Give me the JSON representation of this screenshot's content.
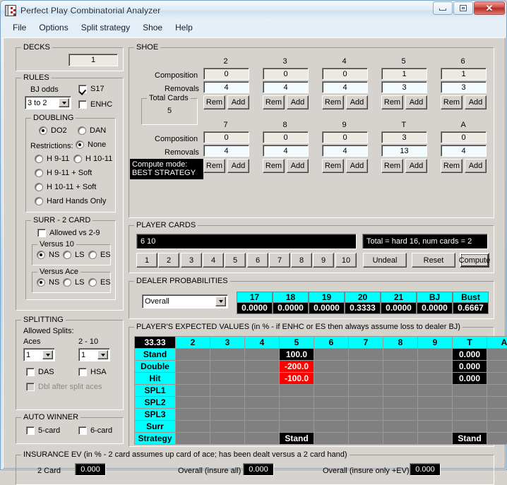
{
  "window": {
    "title": "Perfect Play Combinatorial Analyzer",
    "icon": "playing-card-icon",
    "controls": {
      "minimize": "minimize",
      "maximize": "maximize",
      "close": "close"
    }
  },
  "menubar": [
    "File",
    "Options",
    "Split strategy",
    "Shoe",
    "Help"
  ],
  "decks": {
    "title": "DECKS",
    "value": "1"
  },
  "rules": {
    "title": "RULES",
    "bj_odds_label": "BJ odds",
    "bj_odds_value": "3 to 2",
    "s17": {
      "label": "S17",
      "checked": true
    },
    "enhc": {
      "label": "ENHC",
      "checked": false
    },
    "doubling": {
      "title": "DOUBLING",
      "do2": {
        "label": "DO2",
        "selected": true
      },
      "dan": {
        "label": "DAN",
        "selected": false
      },
      "restrictions_label": "Restrictions:",
      "options": [
        {
          "label": "None",
          "selected": true
        },
        {
          "label": "H 9-11",
          "selected": false
        },
        {
          "label": "H 10-11",
          "selected": false
        },
        {
          "label": "H 9-11 + Soft",
          "selected": false
        },
        {
          "label": "H 10-11 + Soft",
          "selected": false
        },
        {
          "label": "Hard Hands Only",
          "selected": false
        }
      ]
    },
    "surrender": {
      "title": "SURR - 2 CARD",
      "allowed_vs_29": {
        "label": "Allowed vs 2-9",
        "checked": false
      },
      "versus_10": {
        "title": "Versus 10",
        "options": [
          "NS",
          "LS",
          "ES"
        ],
        "selected": "NS"
      },
      "versus_ace": {
        "title": "Versus Ace",
        "options": [
          "NS",
          "LS",
          "ES"
        ],
        "selected": "NS"
      }
    }
  },
  "splitting": {
    "title": "SPLITTING",
    "allowed_splits_label": "Allowed Splits:",
    "aces_label": "Aces",
    "aces_value": "1",
    "two_ten_label": "2 - 10",
    "two_ten_value": "1",
    "das": {
      "label": "DAS",
      "checked": false
    },
    "hsa": {
      "label": "HSA",
      "checked": false
    },
    "dbl_after_split_aces": {
      "label": "Dbl after split aces",
      "checked": false,
      "disabled": true
    }
  },
  "auto_winner": {
    "title": "AUTO WINNER",
    "five_card": {
      "label": "5-card",
      "checked": false
    },
    "six_card": {
      "label": "6-card",
      "checked": false
    }
  },
  "shoe": {
    "title": "SHOE",
    "composition_label": "Composition",
    "removals_label": "Removals",
    "rem_button": "Rem",
    "add_button": "Add",
    "total_cards": {
      "title": "Total Cards",
      "value": "5"
    },
    "compute_mode": {
      "label": "Compute mode:",
      "value": "BEST STRATEGY"
    },
    "row1": [
      {
        "rank": "2",
        "composition": "0",
        "removals": "4"
      },
      {
        "rank": "3",
        "composition": "0",
        "removals": "4"
      },
      {
        "rank": "4",
        "composition": "0",
        "removals": "4"
      },
      {
        "rank": "5",
        "composition": "1",
        "removals": "3"
      },
      {
        "rank": "6",
        "composition": "1",
        "removals": "3"
      }
    ],
    "row2": [
      {
        "rank": "7",
        "composition": "0",
        "removals": "4"
      },
      {
        "rank": "8",
        "composition": "0",
        "removals": "4"
      },
      {
        "rank": "9",
        "composition": "0",
        "removals": "4"
      },
      {
        "rank": "T",
        "composition": "3",
        "removals": "13"
      },
      {
        "rank": "A",
        "composition": "0",
        "removals": "4"
      }
    ]
  },
  "player_cards": {
    "title": "PLAYER CARDS",
    "hand": "6 10",
    "summary": "Total = hard 16, num cards = 2",
    "card_buttons": [
      "1",
      "2",
      "3",
      "4",
      "5",
      "6",
      "7",
      "8",
      "9",
      "10"
    ],
    "undeal": "Undeal",
    "reset": "Reset",
    "compute": "Compute"
  },
  "dealer_probabilities": {
    "title": "DEALER PROBABILITIES",
    "selector_value": "Overall",
    "columns": [
      "17",
      "18",
      "19",
      "20",
      "21",
      "BJ",
      "Bust"
    ],
    "values": [
      "0.0000",
      "0.0000",
      "0.0000",
      "0.3333",
      "0.0000",
      "0.0000",
      "0.6667"
    ]
  },
  "expected_values": {
    "title": "PLAYER'S EXPECTED VALUES (in % - if ENHC or ES then always assume loss to dealer BJ)",
    "corner": "33.33",
    "columns": [
      "2",
      "3",
      "4",
      "5",
      "6",
      "7",
      "8",
      "9",
      "T",
      "A"
    ],
    "rows": [
      {
        "label": "Stand",
        "cells": [
          "",
          "",
          "",
          "100.0",
          "",
          "",
          "",
          "",
          "0.000",
          ""
        ]
      },
      {
        "label": "Double",
        "cells": [
          "",
          "",
          "",
          "-200.0",
          "",
          "",
          "",
          "",
          "0.000",
          ""
        ]
      },
      {
        "label": "Hit",
        "cells": [
          "",
          "",
          "",
          "-100.0",
          "",
          "",
          "",
          "",
          "0.000",
          ""
        ]
      },
      {
        "label": "SPL1",
        "cells": [
          "",
          "",
          "",
          "",
          "",
          "",
          "",
          "",
          "",
          ""
        ]
      },
      {
        "label": "SPL2",
        "cells": [
          "",
          "",
          "",
          "",
          "",
          "",
          "",
          "",
          "",
          ""
        ]
      },
      {
        "label": "SPL3",
        "cells": [
          "",
          "",
          "",
          "",
          "",
          "",
          "",
          "",
          "",
          ""
        ]
      },
      {
        "label": "Surr",
        "cells": [
          "",
          "",
          "",
          "",
          "",
          "",
          "",
          "",
          "",
          ""
        ]
      },
      {
        "label": "Strategy",
        "cells": [
          "",
          "",
          "",
          "Stand",
          "",
          "",
          "",
          "",
          "Stand",
          ""
        ]
      }
    ],
    "cell_styles": [
      [
        "",
        "",
        "",
        "black",
        "",
        "",
        "",
        "",
        "black",
        ""
      ],
      [
        "",
        "",
        "",
        "red",
        "",
        "",
        "",
        "",
        "black",
        ""
      ],
      [
        "",
        "",
        "",
        "red",
        "",
        "",
        "",
        "",
        "black",
        ""
      ],
      [
        "",
        "",
        "",
        "",
        "",
        "",
        "",
        "",
        "",
        ""
      ],
      [
        "",
        "",
        "",
        "",
        "",
        "",
        "",
        "",
        "",
        ""
      ],
      [
        "",
        "",
        "",
        "",
        "",
        "",
        "",
        "",
        "",
        ""
      ],
      [
        "",
        "",
        "",
        "",
        "",
        "",
        "",
        "",
        "",
        ""
      ],
      [
        "",
        "",
        "",
        "black",
        "",
        "",
        "",
        "",
        "black",
        ""
      ]
    ]
  },
  "insurance": {
    "title": "INSURANCE EV (in % - 2 card assumes up card of ace; has been dealt versus a 2 card hand)",
    "two_card_label": "2 Card",
    "two_card_value": "0.000",
    "overall_all_label": "Overall (insure all)",
    "overall_all_value": "0.000",
    "overall_pos_label": "Overall (insure only +EV)",
    "overall_pos_value": "0.000"
  },
  "colors": {
    "cyan": "#00ffff",
    "red": "#ff0000",
    "black": "#000000",
    "gray": "#808080",
    "face": "#d6d3ce"
  }
}
